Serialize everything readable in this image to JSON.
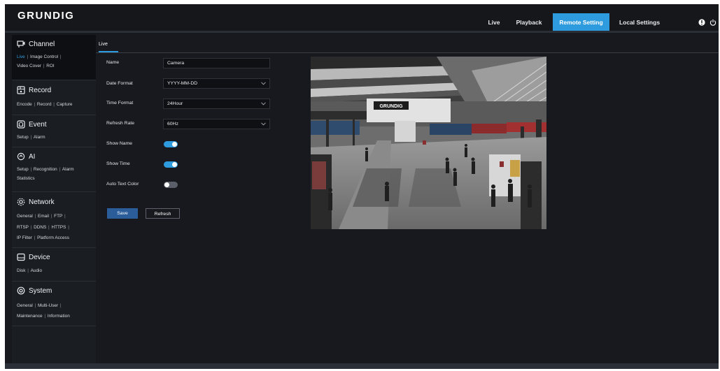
{
  "header": {
    "logo": "GRUNDIG",
    "nav": [
      {
        "label": "Live"
      },
      {
        "label": "Playback"
      },
      {
        "label": "Remote Setting"
      },
      {
        "label": "Local Settings"
      }
    ]
  },
  "sidebar": {
    "groups": [
      {
        "title": "Channel",
        "icon": "channel-icon",
        "links": [
          "Live",
          "Image Control",
          "Video Cover",
          "ROI"
        ]
      },
      {
        "title": "Record",
        "icon": "record-icon",
        "links": [
          "Encode",
          "Record",
          "Capture"
        ]
      },
      {
        "title": "Event",
        "icon": "event-icon",
        "links": [
          "Setup",
          "Alarm"
        ]
      },
      {
        "title": "AI",
        "icon": "ai-icon",
        "links": [
          "Setup",
          "Recognition",
          "Alarm",
          "Statistics"
        ]
      },
      {
        "title": "Network",
        "icon": "network-icon",
        "links": [
          "General",
          "Email",
          "FTP",
          "RTSP",
          "DDNS",
          "HTTPS",
          "IP Filter",
          "Platform Access"
        ]
      },
      {
        "title": "Device",
        "icon": "device-icon",
        "links": [
          "Disk",
          "Audio"
        ]
      },
      {
        "title": "System",
        "icon": "system-icon",
        "links": [
          "General",
          "Multi-User",
          "Maintenance",
          "Information"
        ]
      }
    ]
  },
  "main": {
    "tab": "Live",
    "form": {
      "name_label": "Name",
      "name_value": "Camera",
      "date_format_label": "Date Format",
      "date_format_value": "YYYY-MM-DD",
      "time_format_label": "Time Format",
      "time_format_value": "24Hour",
      "refresh_rate_label": "Refresh Rate",
      "refresh_rate_value": "60Hz",
      "show_name_label": "Show Name",
      "show_name_on": true,
      "show_time_label": "Show Time",
      "show_time_on": true,
      "auto_text_color_label": "Auto Text Color",
      "auto_text_color_on": false
    },
    "buttons": {
      "save": "Save",
      "refresh": "Refresh"
    },
    "preview_sign": "GRUNDIG"
  },
  "colors": {
    "accent": "#2e9bde",
    "background": "#17191e",
    "sidebar": "#1a1d22"
  }
}
